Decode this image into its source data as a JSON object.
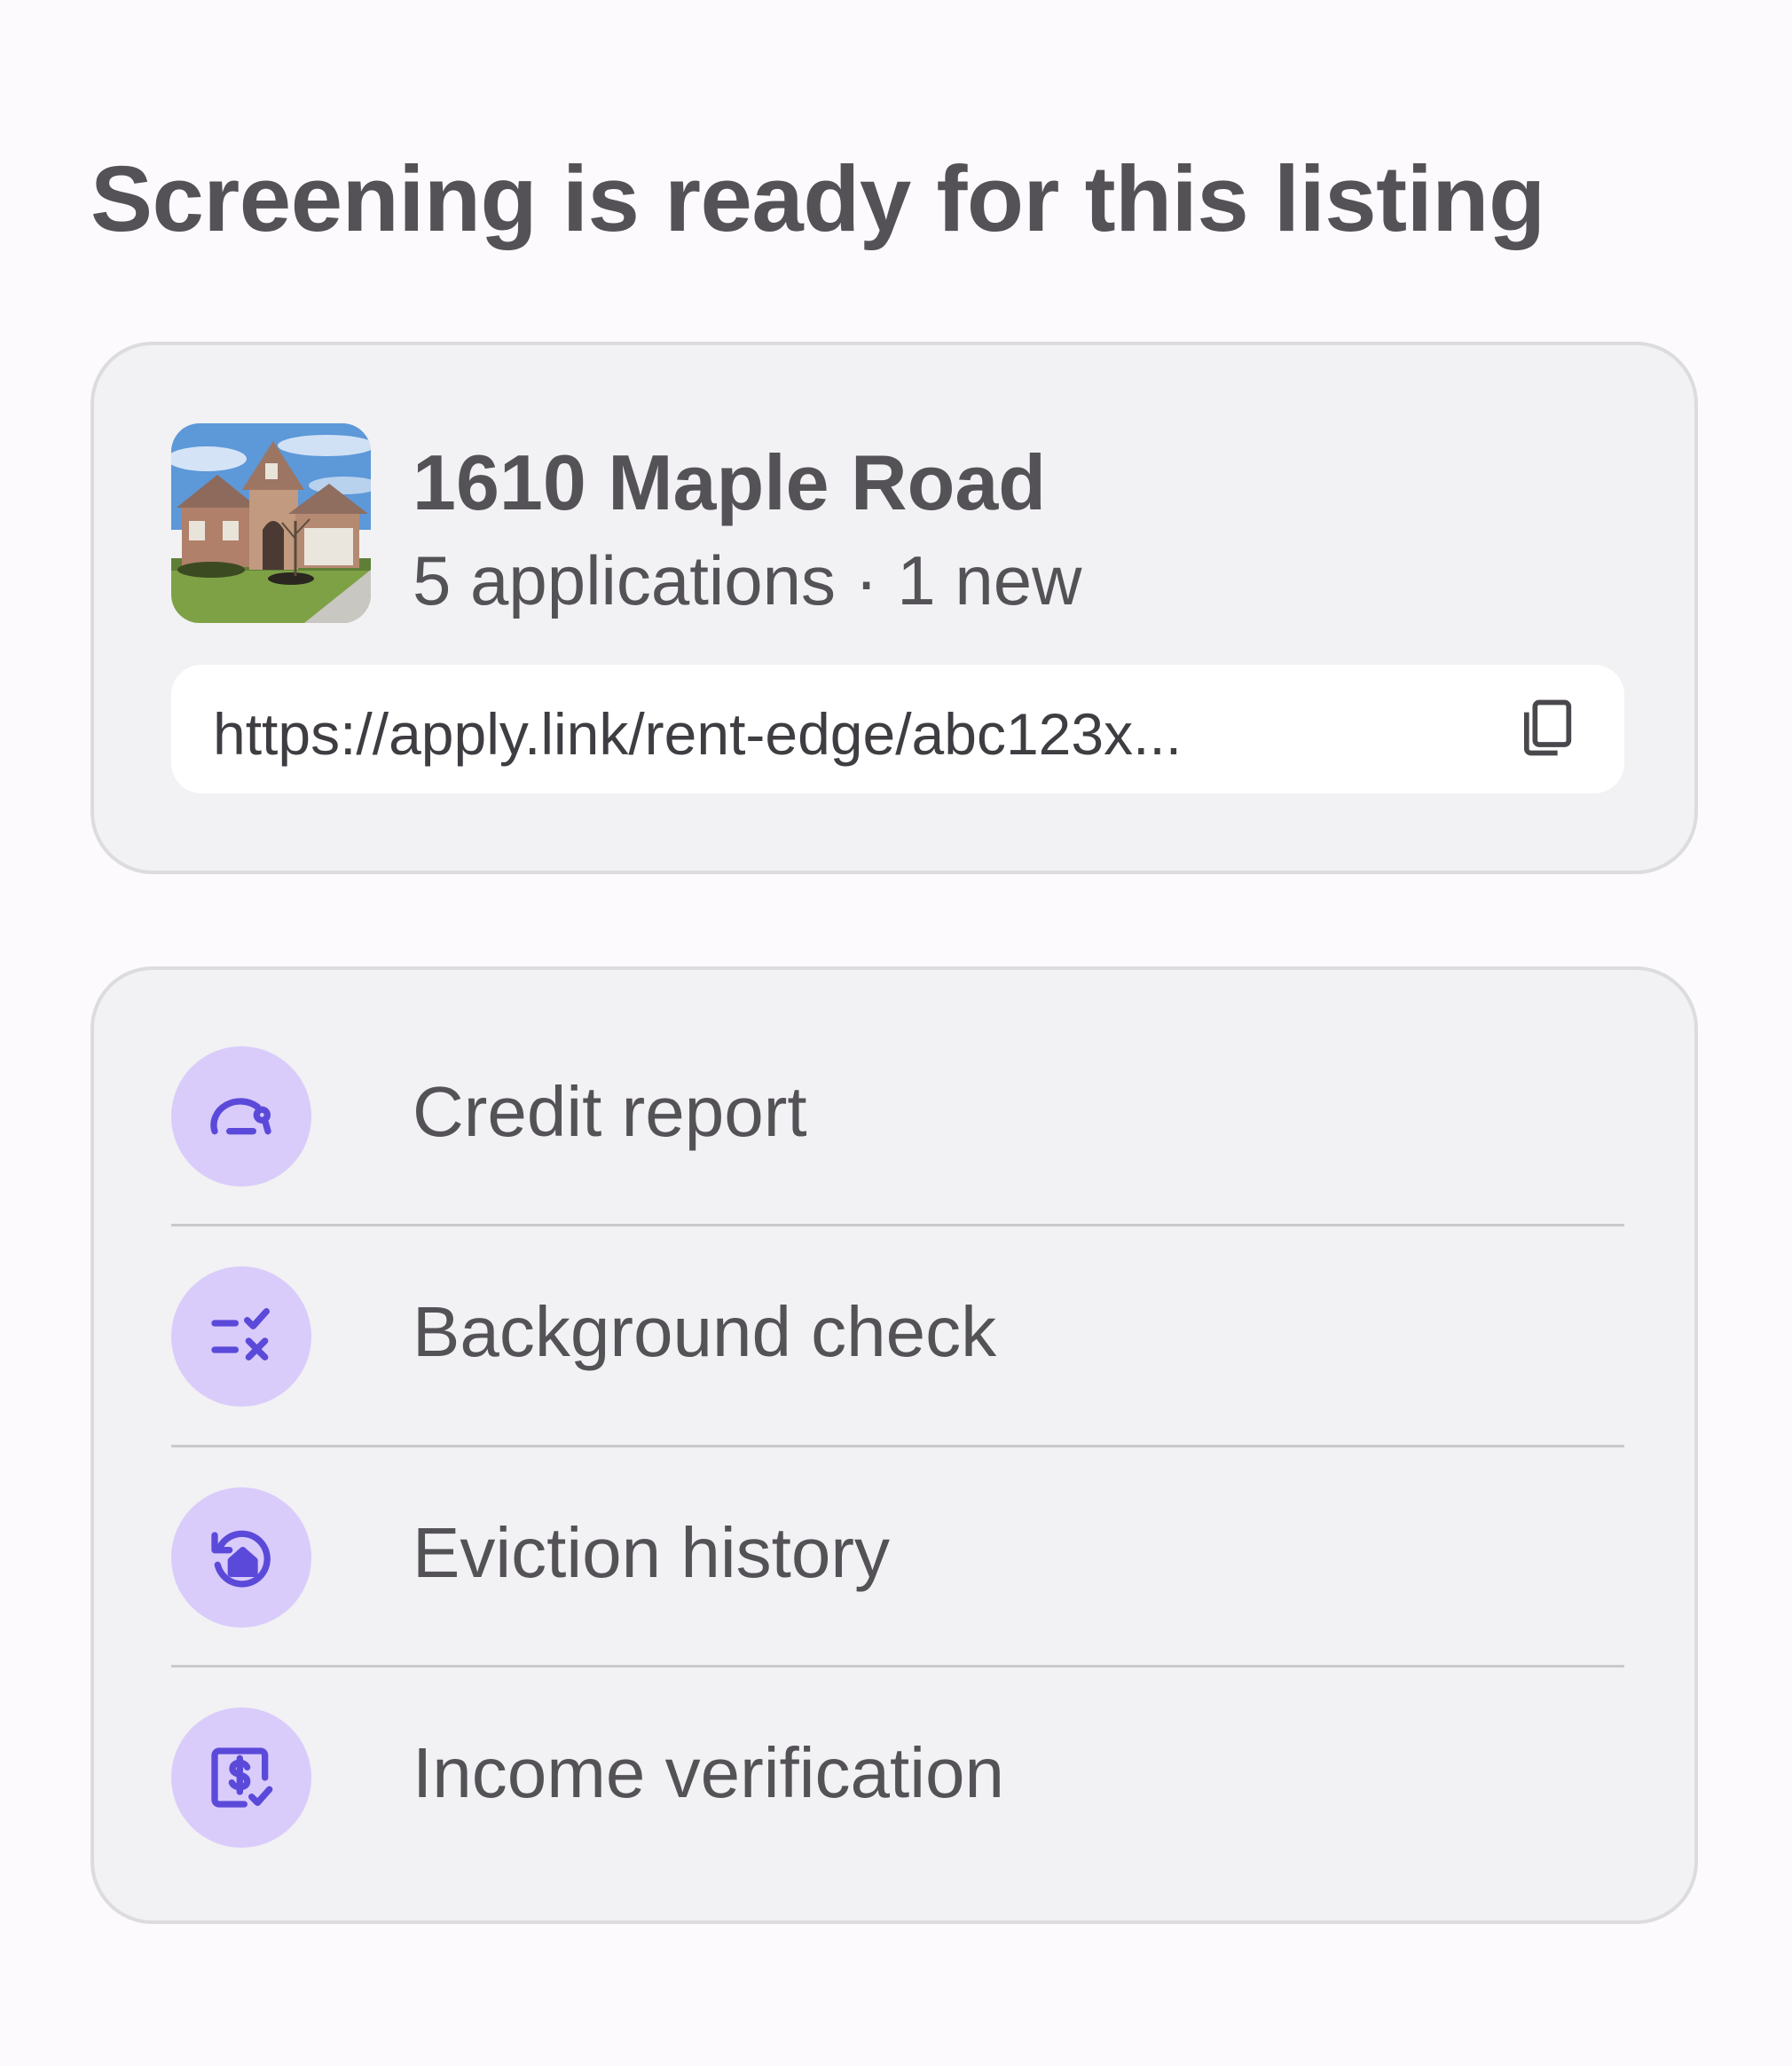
{
  "page": {
    "title": "Screening is ready for this listing"
  },
  "listing": {
    "name": "1610 Maple Road",
    "applications_summary": "5 applications · 1 new",
    "photo_icon": "house-photo",
    "apply_link": "https://apply.link/rent-edge/abc123x...",
    "copy_icon": "copy-icon"
  },
  "screening": {
    "items": [
      {
        "label": "Credit report",
        "icon": "gauge-icon"
      },
      {
        "label": "Background check",
        "icon": "list-check-x-icon"
      },
      {
        "label": "Eviction history",
        "icon": "home-history-icon"
      },
      {
        "label": "Income verification",
        "icon": "dollar-receipt-check-icon"
      }
    ]
  },
  "colors": {
    "background": "#fcfafc",
    "card": "#f2f1f3",
    "card_border": "#dcdbdd",
    "text": "#545257",
    "icon_bg": "#d9ccfb",
    "icon_accent": "#5b4ad9"
  }
}
